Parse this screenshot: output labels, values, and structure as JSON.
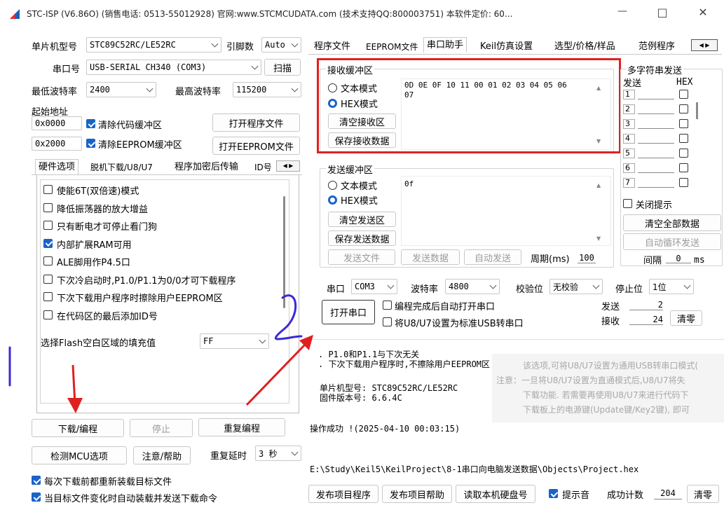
{
  "window": {
    "title": "STC-ISP (V6.86O) (销售电话: 0513-55012928) 官网:www.STCMCUDATA.com  (技术支持QQ:800003751) 本软件定价: 60...",
    "controls": [
      "—",
      "□",
      "✕"
    ]
  },
  "left": {
    "mcu_label": "单片机型号",
    "mcu_value": "STC89C52RC/LE52RC",
    "pins_label": "引脚数",
    "pins_value": "Auto",
    "port_label": "串口号",
    "port_value": "USB-SERIAL CH340 (COM3)",
    "scan_label": "扫描",
    "min_baud_label": "最低波特率",
    "min_baud_value": "2400",
    "max_baud_label": "最高波特率",
    "max_baud_value": "115200",
    "start_addr_label": "起始地址",
    "addr1": "0x0000",
    "clear_code_label": "清除代码缓冲区",
    "open_prog_label": "打开程序文件",
    "addr2": "0x2000",
    "clear_eeprom_label": "清除EEPROM缓冲区",
    "open_eeprom_label": "打开EEPROM文件",
    "tabs": [
      "硬件选项",
      "脱机下载/U8/U7",
      "程序加密后传输",
      "ID号"
    ],
    "options": [
      {
        "label": "使能6T(双倍速)模式",
        "checked": false
      },
      {
        "label": "降低振荡器的放大增益",
        "checked": false
      },
      {
        "label": "只有断电才可停止看门狗",
        "checked": false
      },
      {
        "label": "内部扩展RAM可用",
        "checked": true
      },
      {
        "label": "ALE脚用作P4.5口",
        "checked": false
      },
      {
        "label": "下次冷启动时,P1.0/P1.1为0/0才可下载程序",
        "checked": false
      },
      {
        "label": "下次下载用户程序时擦除用户EEPROM区",
        "checked": false
      },
      {
        "label": "在代码区的最后添加ID号",
        "checked": false
      }
    ],
    "fill_label": "选择Flash空白区域的填充值",
    "fill_value": "FF",
    "download_label": "下载/编程",
    "stop_label": "停止",
    "repeat_label": "重复编程",
    "check_mcu_label": "检测MCU选项",
    "help_label": "注意/帮助",
    "delay_label": "重复延时",
    "delay_value": "3 秒",
    "reload_label": "每次下载前都重新装载目标文件",
    "auto_send_label": "当目标文件变化时自动装载并发送下载命令"
  },
  "right": {
    "tabs": [
      "程序文件",
      "EEPROM文件",
      "串口助手",
      "Keil仿真设置",
      "选型/价格/样品",
      "范例程序"
    ],
    "active_tab": "串口助手",
    "recv": {
      "title": "接收缓冲区",
      "text_mode": "文本模式",
      "hex_mode": "HEX模式",
      "clear": "清空接收区",
      "save": "保存接收数据",
      "content_line1": "0D 0E 0F 10 11 00 01 02 03 04 05 06",
      "content_line2": "07"
    },
    "send": {
      "title": "发送缓冲区",
      "text_mode": "文本模式",
      "hex_mode": "HEX模式",
      "clear": "清空发送区",
      "save": "保存发送数据",
      "content": "0f",
      "send_file": "发送文件",
      "send_data": "发送数据",
      "auto_send": "自动发送",
      "period_label": "周期(ms)",
      "period_value": "100"
    },
    "multi": {
      "title": "多字符串发送",
      "send_col": "发送",
      "hex_col": "HEX",
      "rows": [
        "1",
        "2",
        "3",
        "4",
        "5",
        "6",
        "7"
      ],
      "close_tip": "关闭提示",
      "clear_all": "清空全部数据",
      "auto_loop": "自动循环发送",
      "interval_label": "间隔",
      "interval_value": "0",
      "interval_unit": "ms"
    },
    "serial": {
      "port_label": "串口",
      "port_value": "COM3",
      "baud_label": "波特率",
      "baud_value": "4800",
      "parity_label": "校验位",
      "parity_value": "无校验",
      "stop_label": "停止位",
      "stop_value": "1位",
      "open_btn": "打开串口",
      "auto_open": "编程完成后自动打开串口",
      "usb_set": "将U8/U7设置为标准USB转串口",
      "sent_label": "发送",
      "sent_value": "2",
      "recv_label": "接收",
      "recv_value": "24",
      "clear_cnt": "清零"
    },
    "log": {
      "line1": ". P1.0和P1.1与下次无关",
      "line2": ". 下次下载用户程序时,不擦除用户EEPROM区",
      "chip_line": "单片机型号: STC89C52RC/LE52RC",
      "fw_line": "固件版本号: 6.6.4C",
      "success": "操作成功 !(2025-04-10 00:03:15)",
      "tip1": "该选项,可将U8/U7设置为通用USB转串口模式(",
      "tip2": "注意：一旦将U8/U7设置为直通模式后,U8/U7将失",
      "tip3": "下载功能. 若需要再使用U8/U7来进行代码下",
      "tip4": "下载板上的电源键(Update键/Key2键), 即可"
    },
    "path": "E:\\Study\\Keil5\\KeilProject\\8-1串口向电脑发送数据\\Objects\\Project.hex",
    "bottom": {
      "publish": "发布项目程序",
      "publish_help": "发布项目帮助",
      "read_hdd": "读取本机硬盘号",
      "beep": "提示音",
      "success_count_label": "成功计数",
      "success_count": "204",
      "clear": "清零"
    }
  },
  "colors": {
    "accent": "#1a63c9",
    "highlight_red": "#e02020",
    "annotation_blue": "#3b2ad6"
  }
}
